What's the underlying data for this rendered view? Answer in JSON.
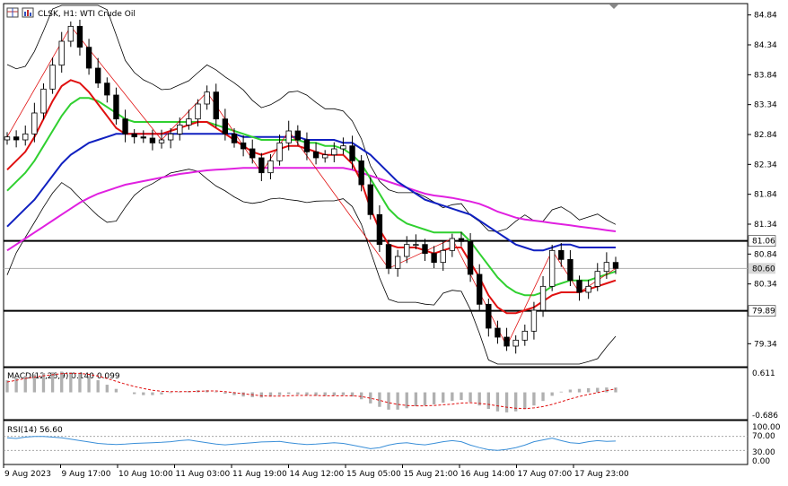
{
  "header": {
    "symbol_line": "CLSK, H1: WTI Crude Oil"
  },
  "toolbar_icons": [
    "grid-icon",
    "chart-settings-icon"
  ],
  "colors": {
    "bull_candle": "#ffffff",
    "bear_candle": "#000000",
    "ma_fast": "#e01010",
    "ma_medium": "#30d030",
    "ma_slow": "#1020c0",
    "ma_long": "#e020e0",
    "bollinger": "#000000",
    "zigzag": "#e01010",
    "macd_hist": "#b0b0b0",
    "macd_signal": "#e01010",
    "rsi_line": "#3a8fd8",
    "price_tag_bg": "#d8d8d8",
    "horizontal_line": "#000000"
  },
  "price_axis": {
    "ticks": [
      "84.84",
      "84.34",
      "83.84",
      "83.34",
      "82.84",
      "82.34",
      "81.84",
      "81.34",
      "80.84",
      "80.34",
      "79.34"
    ],
    "current_price": "80.60",
    "level_high": "81.06",
    "level_low": "79.89"
  },
  "time_axis": {
    "labels": [
      "9 Aug 2023",
      "9 Aug 17:00",
      "10 Aug 10:00",
      "11 Aug 03:00",
      "11 Aug 19:00",
      "14 Aug 12:00",
      "15 Aug 05:00",
      "15 Aug 21:00",
      "16 Aug 14:00",
      "17 Aug 07:00",
      "17 Aug 23:00"
    ]
  },
  "macd_panel": {
    "label": "MACD(12,26,9) 0.140 0.099",
    "ticks": [
      "0.611",
      "-0.686"
    ]
  },
  "rsi_panel": {
    "label": "RSI(14) 56.60",
    "ticks": [
      "100.00",
      "70.00",
      "30.00",
      "0.00"
    ]
  },
  "chart_data": {
    "type": "candlestick",
    "symbol": "CLSK",
    "timeframe": "H1",
    "ylim": [
      79.0,
      85.0
    ],
    "x_labels": [
      "9 Aug 2023",
      "9 Aug 17:00",
      "10 Aug 10:00",
      "11 Aug 03:00",
      "11 Aug 19:00",
      "14 Aug 12:00",
      "15 Aug 05:00",
      "15 Aug 21:00",
      "16 Aug 14:00",
      "17 Aug 07:00",
      "17 Aug 23:00"
    ],
    "close_path": [
      82.8,
      82.75,
      82.85,
      83.2,
      83.6,
      84.0,
      84.4,
      84.65,
      84.3,
      83.95,
      83.7,
      83.5,
      83.1,
      82.85,
      82.8,
      82.78,
      82.7,
      82.75,
      82.85,
      83.0,
      83.1,
      83.35,
      83.55,
      83.1,
      82.85,
      82.7,
      82.6,
      82.45,
      82.2,
      82.4,
      82.7,
      82.9,
      82.75,
      82.55,
      82.45,
      82.5,
      82.6,
      82.65,
      82.4,
      82.0,
      81.5,
      81.0,
      80.6,
      80.8,
      81.0,
      81.0,
      80.85,
      80.7,
      80.9,
      81.1,
      81.05,
      80.5,
      80.0,
      79.6,
      79.45,
      79.3,
      79.4,
      79.55,
      79.9,
      80.3,
      80.9,
      80.75,
      80.4,
      80.2,
      80.3,
      80.55,
      80.7,
      80.6
    ],
    "ma_red": [
      82.25,
      82.4,
      82.55,
      82.8,
      83.1,
      83.4,
      83.65,
      83.75,
      83.7,
      83.55,
      83.35,
      83.15,
      82.95,
      82.85,
      82.85,
      82.85,
      82.85,
      82.85,
      82.9,
      82.95,
      83.0,
      83.05,
      83.05,
      82.95,
      82.85,
      82.75,
      82.65,
      82.55,
      82.5,
      82.55,
      82.6,
      82.65,
      82.65,
      82.6,
      82.55,
      82.5,
      82.5,
      82.5,
      82.35,
      82.05,
      81.6,
      81.25,
      81.0,
      80.95,
      80.95,
      80.95,
      80.9,
      80.85,
      80.9,
      80.95,
      80.95,
      80.7,
      80.45,
      80.15,
      79.95,
      79.85,
      79.85,
      79.9,
      79.95,
      80.05,
      80.15,
      80.2,
      80.2,
      80.2,
      80.25,
      80.3,
      80.35,
      80.4
    ],
    "ma_green": [
      81.9,
      82.05,
      82.2,
      82.4,
      82.65,
      82.9,
      83.15,
      83.35,
      83.45,
      83.45,
      83.4,
      83.3,
      83.2,
      83.1,
      83.05,
      83.05,
      83.05,
      83.05,
      83.05,
      83.05,
      83.05,
      83.05,
      83.05,
      83.0,
      82.95,
      82.9,
      82.85,
      82.8,
      82.75,
      82.75,
      82.75,
      82.75,
      82.75,
      82.7,
      82.7,
      82.65,
      82.65,
      82.6,
      82.5,
      82.35,
      82.1,
      81.85,
      81.6,
      81.45,
      81.35,
      81.3,
      81.25,
      81.2,
      81.2,
      81.2,
      81.2,
      81.05,
      80.85,
      80.65,
      80.45,
      80.3,
      80.2,
      80.15,
      80.15,
      80.2,
      80.3,
      80.35,
      80.4,
      80.4,
      80.4,
      80.45,
      80.5,
      80.55
    ],
    "ma_blue": [
      81.3,
      81.45,
      81.6,
      81.75,
      81.95,
      82.15,
      82.35,
      82.5,
      82.6,
      82.7,
      82.75,
      82.8,
      82.85,
      82.85,
      82.85,
      82.85,
      82.85,
      82.85,
      82.85,
      82.85,
      82.85,
      82.85,
      82.85,
      82.85,
      82.85,
      82.85,
      82.8,
      82.8,
      82.8,
      82.8,
      82.8,
      82.8,
      82.8,
      82.75,
      82.75,
      82.75,
      82.75,
      82.7,
      82.7,
      82.6,
      82.5,
      82.35,
      82.2,
      82.05,
      81.95,
      81.85,
      81.75,
      81.7,
      81.65,
      81.6,
      81.55,
      81.5,
      81.4,
      81.3,
      81.2,
      81.1,
      81.0,
      80.95,
      80.9,
      80.9,
      80.95,
      81.0,
      81.0,
      80.95,
      80.95,
      80.95,
      80.95,
      80.95
    ],
    "ma_magenta": [
      80.9,
      81.0,
      81.1,
      81.2,
      81.3,
      81.4,
      81.5,
      81.6,
      81.7,
      81.78,
      81.85,
      81.9,
      81.95,
      82.0,
      82.03,
      82.06,
      82.09,
      82.12,
      82.15,
      82.18,
      82.2,
      82.22,
      82.24,
      82.25,
      82.26,
      82.27,
      82.28,
      82.28,
      82.28,
      82.28,
      82.28,
      82.28,
      82.28,
      82.28,
      82.28,
      82.28,
      82.28,
      82.28,
      82.25,
      82.2,
      82.15,
      82.1,
      82.05,
      82.0,
      81.95,
      81.9,
      81.85,
      81.82,
      81.8,
      81.78,
      81.75,
      81.72,
      81.68,
      81.62,
      81.55,
      81.5,
      81.45,
      81.42,
      81.4,
      81.38,
      81.36,
      81.34,
      81.32,
      81.3,
      81.28,
      81.26,
      81.24,
      81.22
    ],
    "macd_hist": [
      0.35,
      0.42,
      0.48,
      0.52,
      0.56,
      0.58,
      0.6,
      0.58,
      0.54,
      0.45,
      0.35,
      0.22,
      0.1,
      0.0,
      -0.05,
      -0.08,
      -0.08,
      -0.06,
      -0.02,
      0.02,
      0.04,
      0.06,
      0.06,
      0.02,
      -0.04,
      -0.08,
      -0.12,
      -0.14,
      -0.15,
      -0.12,
      -0.08,
      -0.05,
      -0.06,
      -0.08,
      -0.1,
      -0.1,
      -0.09,
      -0.08,
      -0.12,
      -0.2,
      -0.32,
      -0.42,
      -0.5,
      -0.5,
      -0.46,
      -0.4,
      -0.38,
      -0.35,
      -0.3,
      -0.25,
      -0.22,
      -0.28,
      -0.38,
      -0.48,
      -0.55,
      -0.58,
      -0.55,
      -0.48,
      -0.38,
      -0.25,
      -0.1,
      0.02,
      0.08,
      0.1,
      0.12,
      0.13,
      0.14,
      0.14
    ],
    "macd_signal": [
      0.3,
      0.35,
      0.4,
      0.44,
      0.48,
      0.51,
      0.54,
      0.55,
      0.55,
      0.52,
      0.47,
      0.4,
      0.32,
      0.24,
      0.17,
      0.11,
      0.06,
      0.03,
      0.02,
      0.02,
      0.02,
      0.03,
      0.04,
      0.04,
      0.02,
      -0.01,
      -0.04,
      -0.07,
      -0.1,
      -0.11,
      -0.11,
      -0.1,
      -0.09,
      -0.09,
      -0.09,
      -0.1,
      -0.1,
      -0.1,
      -0.1,
      -0.12,
      -0.17,
      -0.23,
      -0.3,
      -0.35,
      -0.38,
      -0.39,
      -0.39,
      -0.38,
      -0.36,
      -0.34,
      -0.31,
      -0.3,
      -0.32,
      -0.35,
      -0.39,
      -0.43,
      -0.46,
      -0.47,
      -0.45,
      -0.41,
      -0.35,
      -0.27,
      -0.19,
      -0.12,
      -0.06,
      -0.01,
      0.05,
      0.099
    ],
    "rsi": [
      66,
      64,
      68,
      70,
      70,
      68,
      66,
      62,
      58,
      54,
      50,
      48,
      47,
      48,
      50,
      51,
      52,
      53,
      55,
      58,
      60,
      56,
      52,
      48,
      46,
      48,
      50,
      52,
      54,
      55,
      56,
      52,
      49,
      47,
      48,
      50,
      52,
      50,
      45,
      40,
      35,
      38,
      45,
      50,
      52,
      48,
      46,
      50,
      55,
      58,
      55,
      45,
      38,
      32,
      30,
      33,
      38,
      45,
      55,
      60,
      65,
      58,
      52,
      50,
      55,
      58,
      56,
      56.6
    ]
  }
}
